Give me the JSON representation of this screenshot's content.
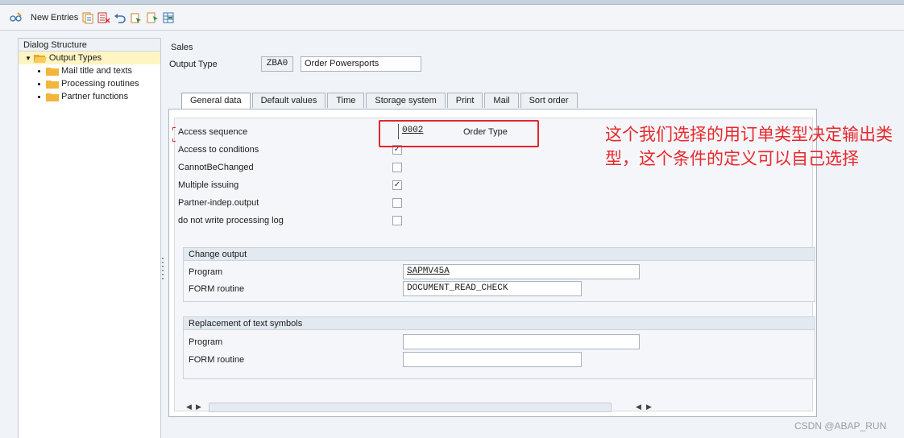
{
  "toolbar": {
    "new_entries_label": "New Entries"
  },
  "sidebar": {
    "header": "Dialog Structure",
    "items": [
      {
        "label": "Output Types"
      },
      {
        "label": "Mail title and texts"
      },
      {
        "label": "Processing routines"
      },
      {
        "label": "Partner functions"
      }
    ]
  },
  "header": {
    "application": "Sales",
    "output_type_label": "Output Type",
    "output_type_code": "ZBA0",
    "output_type_desc": "Order Powersports"
  },
  "tabs": [
    {
      "label": "General data"
    },
    {
      "label": "Default values"
    },
    {
      "label": "Time"
    },
    {
      "label": "Storage system"
    },
    {
      "label": "Print"
    },
    {
      "label": "Mail"
    },
    {
      "label": "Sort order"
    }
  ],
  "general": {
    "access_sequence_label": "Access sequence",
    "access_sequence_value": "0002",
    "access_sequence_desc": "Order Type",
    "checks": [
      {
        "label": "Access to conditions",
        "checked": "✓"
      },
      {
        "label": "CannotBeChanged",
        "checked": ""
      },
      {
        "label": "Multiple issuing",
        "checked": "✓"
      },
      {
        "label": "Partner-indep.output",
        "checked": ""
      },
      {
        "label": "do not write processing log",
        "checked": ""
      }
    ]
  },
  "change_output": {
    "title": "Change output",
    "program_label": "Program",
    "program_value": "SAPMV45A",
    "form_label": "FORM routine",
    "form_value": "DOCUMENT_READ_CHECK"
  },
  "replacement": {
    "title": "Replacement of text symbols",
    "program_label": "Program",
    "program_value": "",
    "form_label": "FORM routine",
    "form_value": ""
  },
  "annotation": "这个我们选择的用订单类型决定输出类型，这个条件的定义可以自己选择",
  "watermark": "CSDN @ABAP_RUN",
  "colors": {
    "highlight": "#e3262b",
    "folder": "#f2b63c"
  }
}
